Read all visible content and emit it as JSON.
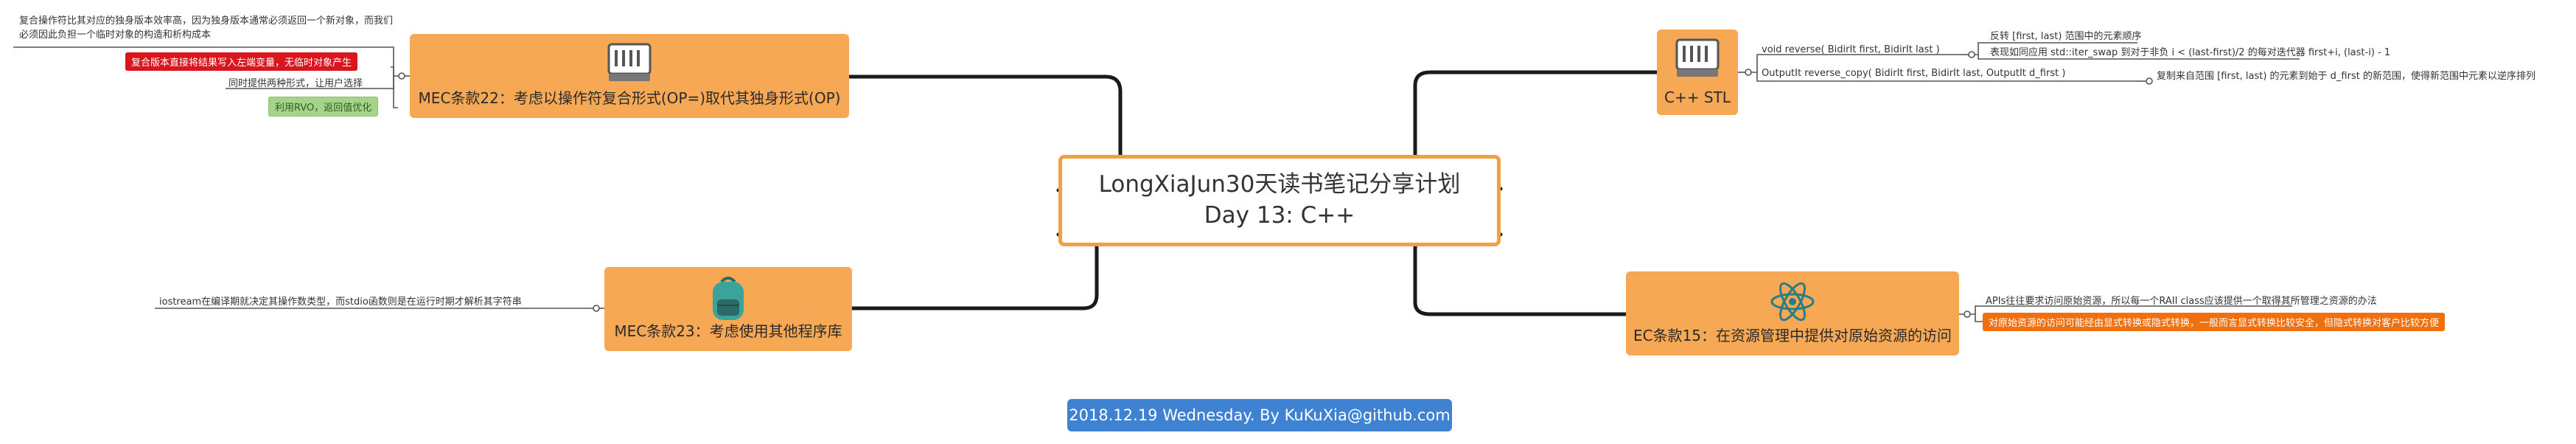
{
  "central": {
    "line1": "LongXiaJun30天读书笔记分享计划",
    "line2": "Day 13: C++"
  },
  "footer": "2018.12.19 Wednesday. By KuKuXia@github.com",
  "colors": {
    "topic": "#f7a855",
    "central_border": "#f0a040",
    "footer": "#3f82d2",
    "tag_red": "#d9161e",
    "tag_green": "#a6d38a",
    "tag_orange": "#f07010"
  },
  "topics": {
    "mec22": {
      "title": "MEC条款22：考虑以操作符复合形式(OP=)取代其独身形式(OP)",
      "icon": "server-icon",
      "notes": {
        "n1": "复合操作符比其对应的独身版本效率高，因为独身版本通常必须返回一个新对象，而我们必须因此负担一个临时对象的构造和析构成本",
        "n2": "复合版本直接将结果写入左端变量，无临时对象产生",
        "n3": "同时提供两种形式，让用户选择",
        "n4": "利用RVO，返回值优化"
      }
    },
    "mec23": {
      "title": "MEC条款23：考虑使用其他程序库",
      "icon": "backpack-icon",
      "notes": {
        "n1": "iostream在编译期就决定其操作数类型，而stdio函数则是在运行时期才解析其字符串"
      }
    },
    "stl": {
      "title": "C++ STL",
      "icon": "server-icon",
      "items": [
        {
          "sig": "void reverse( BidirIt first, BidirIt last )",
          "desc1": "反转 [first, last) 范围中的元素顺序",
          "desc2": "表现如同应用 std::iter_swap 到对于非负 i < (last-first)/2 的每对迭代器 first+i, (last-i) - 1"
        },
        {
          "sig": "OutputIt reverse_copy( BidirIt first, BidirIt last, OutputIt d_first )",
          "desc1": "复制来自范围 [first, last) 的元素到始于 d_first 的新范围，使得新范围中元素以逆序排列"
        }
      ]
    },
    "ec15": {
      "title": "EC条款15：在资源管理中提供对原始资源的访问",
      "icon": "atom-icon",
      "notes": {
        "n1": "APIs往往要求访问原始资源，所以每一个RAII class应该提供一个取得其所管理之资源的办法",
        "n2": "对原始资源的访问可能经由显式转换或隐式转换，一般而言显式转换比较安全，但隐式转换对客户比较方便"
      }
    }
  }
}
